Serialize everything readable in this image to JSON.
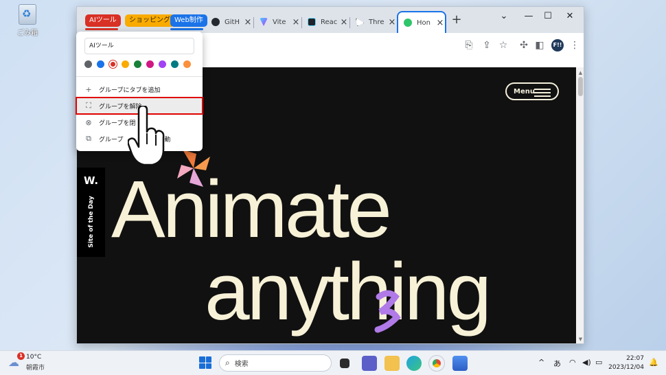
{
  "desktop": {
    "recycle_bin_label": "ごみ箱"
  },
  "tabs": {
    "groups": [
      {
        "label": "AIツール",
        "color": "#d93025"
      },
      {
        "label": "ショッピング",
        "color": "#f9ab00"
      },
      {
        "label": "Web制作",
        "color": "#1a73e8"
      }
    ],
    "items": [
      {
        "label": "GitH",
        "favicon": "github-icon"
      },
      {
        "label": "Vite",
        "favicon": "vite-icon"
      },
      {
        "label": "Reac",
        "favicon": "react-icon"
      },
      {
        "label": "Thre",
        "favicon": "threejs-icon"
      },
      {
        "label": "Hon",
        "favicon": "clover-icon",
        "active": true
      }
    ],
    "new_tab": "+"
  },
  "window_controls": {
    "chevron": "⌄",
    "minimize": "—",
    "maximize": "☐",
    "close": "✕"
  },
  "toolbar": {
    "profile": "F!!"
  },
  "page": {
    "menu_label": "Menu",
    "hero_line1": "Animate",
    "hero_line2": "anything",
    "award_mark": "W.",
    "award_text": "Site of the Day"
  },
  "group_menu": {
    "name_value": "AIツール",
    "colors": [
      "#5f6368",
      "#1a73e8",
      "#d93025",
      "#f9ab00",
      "#188038",
      "#d01884",
      "#a142f4",
      "#007b83",
      "#fa903e"
    ],
    "selected_color": 2,
    "items": [
      {
        "label": "グループにタブを追加",
        "icon": "plus-icon"
      },
      {
        "label": "グループを解除",
        "icon": "ungroup-icon",
        "highlighted": true
      },
      {
        "label": "グループを閉",
        "icon": "close-circle-icon"
      },
      {
        "label": "グループ",
        "suffix": "に移動",
        "icon": "move-window-icon"
      }
    ]
  },
  "taskbar": {
    "weather_temp": "10°C",
    "weather_location": "朝霞市",
    "weather_badge": "1",
    "search_placeholder": "検索",
    "ime": "あ",
    "time": "22:07",
    "date": "2023/12/04"
  }
}
